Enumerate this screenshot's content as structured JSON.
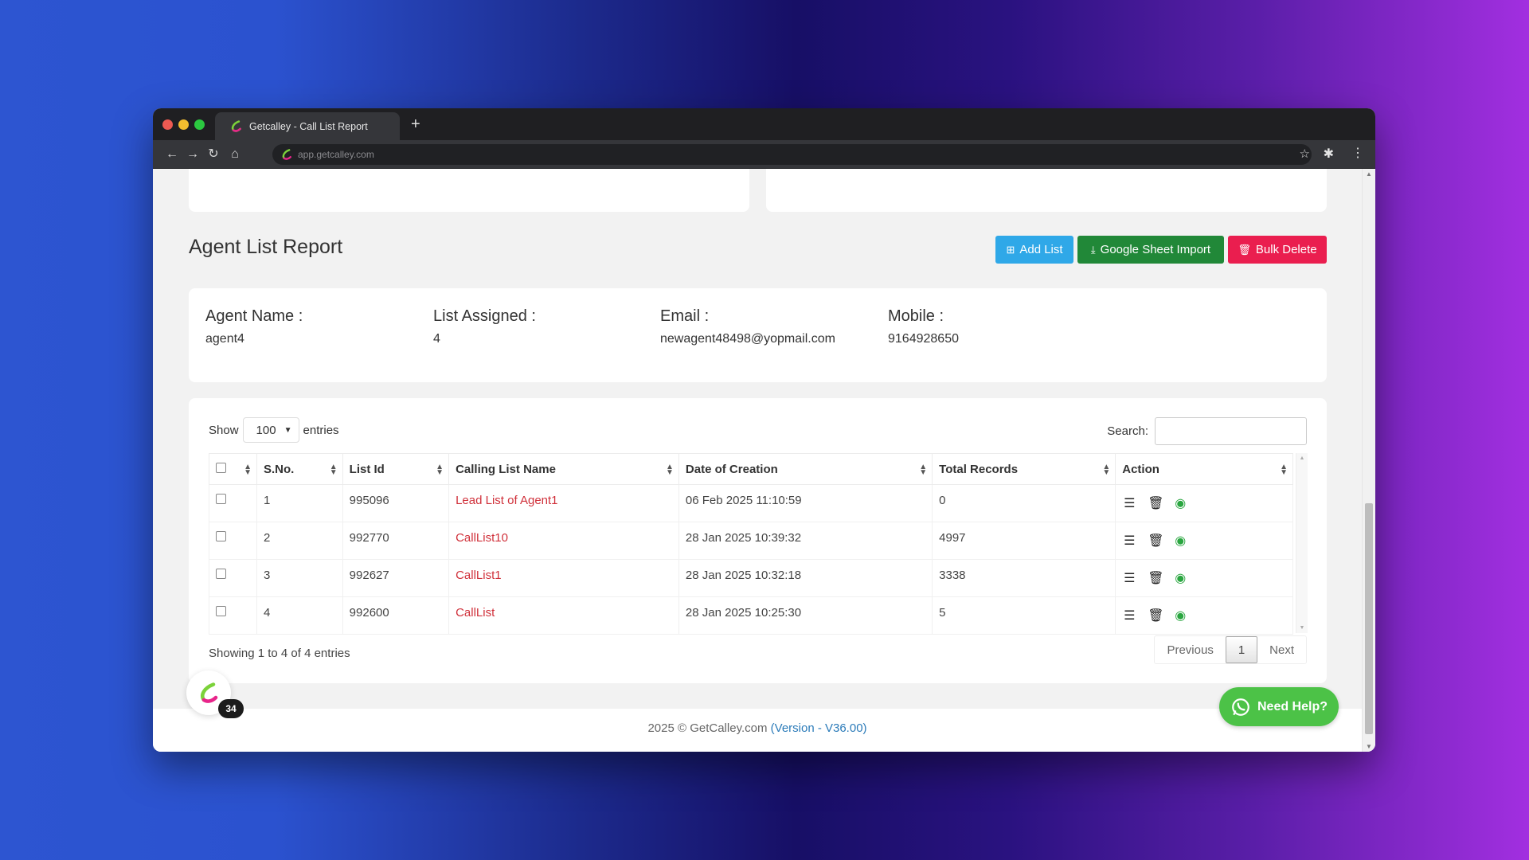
{
  "browser": {
    "tab_title": "Getcalley - Call List Report",
    "new_tab": "+",
    "url": "app.getcalley.com",
    "icons": {
      "back": "←",
      "forward": "→",
      "reload": "↻",
      "home": "⌂",
      "star": "☆",
      "extensions": "✱",
      "menu": "⋮"
    }
  },
  "page": {
    "title": "Agent List Report",
    "buttons": {
      "add_list": "Add List",
      "google_sheet_import": "Google Sheet Import",
      "bulk_delete": "Bulk Delete"
    },
    "colors": {
      "add": "#2fa8e8",
      "import": "#218838",
      "delete": "#ea1e4f",
      "link": "#d0303a",
      "view": "#2aa640"
    }
  },
  "agent": {
    "name_label": "Agent Name :",
    "name": "agent4",
    "lists_label": "List Assigned :",
    "lists": "4",
    "email_label": "Email :",
    "email": "newagent48498@yopmail.com",
    "mobile_label": "Mobile :",
    "mobile": "9164928650"
  },
  "table": {
    "show_label": "Show",
    "entries_label": "entries",
    "page_size": "100",
    "search_label": "Search:",
    "search_value": "",
    "columns": [
      "S.No.",
      "List Id",
      "Calling List Name",
      "Date of Creation",
      "Total Records",
      "Action"
    ],
    "rows": [
      {
        "sno": "1",
        "list_id": "995096",
        "name": "Lead List of Agent1",
        "created": "06 Feb 2025 11:10:59",
        "total": "0"
      },
      {
        "sno": "2",
        "list_id": "992770",
        "name": "CallList10",
        "created": "28 Jan 2025 10:39:32",
        "total": "4997"
      },
      {
        "sno": "3",
        "list_id": "992627",
        "name": "CallList1",
        "created": "28 Jan 2025 10:32:18",
        "total": "3338"
      },
      {
        "sno": "4",
        "list_id": "992600",
        "name": "CallList",
        "created": "28 Jan 2025 10:25:30",
        "total": "5"
      }
    ],
    "showing": "Showing 1 to 4 of 4 entries",
    "pagination": {
      "previous": "Previous",
      "current": "1",
      "next": "Next"
    }
  },
  "footer": {
    "copyright": "2025 © GetCalley.com ",
    "version": "(Version - V36.00)"
  },
  "widgets": {
    "chat_badge": "34",
    "need_help": "Need Help?"
  }
}
